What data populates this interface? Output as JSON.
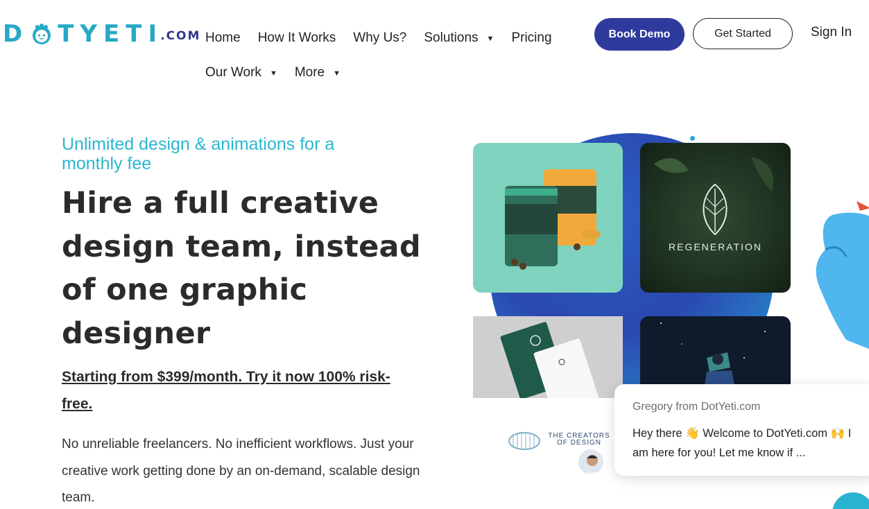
{
  "logo": {
    "wordmark_left": "D",
    "wordmark_right": "TYETI",
    "suffix": ".COM"
  },
  "nav": {
    "row1": [
      {
        "label": "Home",
        "has_caret": false
      },
      {
        "label": "How It Works",
        "has_caret": false
      },
      {
        "label": "Why Us?",
        "has_caret": false
      },
      {
        "label": "Solutions",
        "has_caret": true
      },
      {
        "label": "Pricing",
        "has_caret": false
      }
    ],
    "row2": [
      {
        "label": "Our Work",
        "has_caret": true
      },
      {
        "label": "More",
        "has_caret": true
      }
    ],
    "caret": "▼"
  },
  "header_actions": {
    "book_demo": "Book Demo",
    "get_started": "Get Started",
    "sign_in": "Sign In"
  },
  "hero": {
    "tagline": "Unlimited design & animations for a monthly fee",
    "headline": "Hire a full creative design team, instead of one graphic designer",
    "price_link": "Starting from $399/month. Try it now 100% risk-free.",
    "body": "No unreliable freelancers. No inefficient workflows. Just your creative work getting done by an on-demand, scalable design team."
  },
  "portfolio": {
    "regeneration_label": "REGENERATION",
    "creators_label": "THE CREATORS OF DESIGN"
  },
  "chat": {
    "from": "Gregory from DotYeti.com",
    "message": "Hey there 👋 Welcome to DotYeti.com 🙌  I am here for you! Let me know if ..."
  },
  "colors": {
    "brand_blue": "#2e3a9c",
    "accent_cyan": "#2bb6d0",
    "text_dark": "#2b2b2b"
  }
}
